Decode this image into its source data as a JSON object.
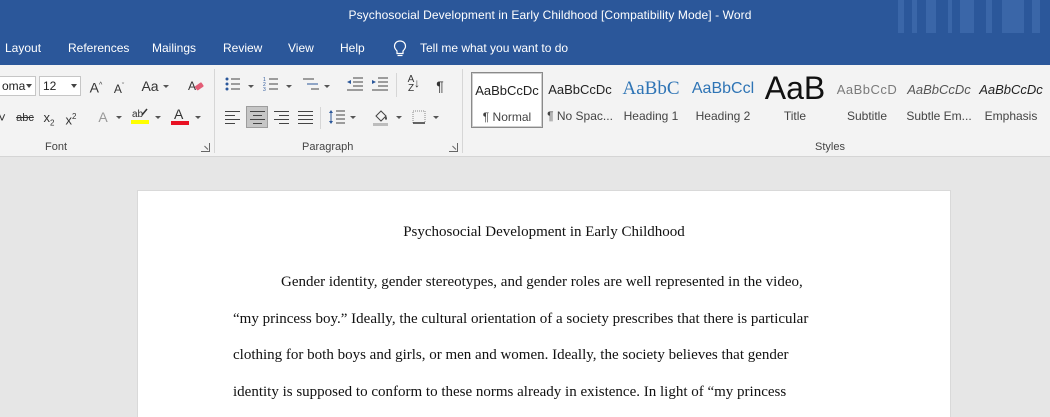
{
  "window": {
    "title": "Psychosocial Development in Early Childhood [Compatibility Mode]  -  Word"
  },
  "tabs": [
    "Layout",
    "References",
    "Mailings",
    "Review",
    "View",
    "Help"
  ],
  "tell_me": "Tell me what you want to do",
  "font": {
    "name_value": "oma",
    "size_value": "12",
    "group_label": "Font"
  },
  "paragraph": {
    "group_label": "Paragraph"
  },
  "styles": {
    "group_label": "Styles",
    "items": [
      {
        "sample": "AaBbCcDc",
        "name": "¶ Normal"
      },
      {
        "sample": "AaBbCcDc",
        "name": "¶ No Spac..."
      },
      {
        "sample": "AaBbC",
        "name": "Heading 1"
      },
      {
        "sample": "AaBbCcl",
        "name": "Heading 2"
      },
      {
        "sample": "AaB",
        "name": "Title"
      },
      {
        "sample": "AaBbCcD",
        "name": "Subtitle"
      },
      {
        "sample": "AaBbCcDc",
        "name": "Subtle Em..."
      },
      {
        "sample": "AaBbCcDc",
        "name": "Emphasis"
      }
    ]
  },
  "colors": {
    "word_blue": "#2b579a",
    "highlight_yellow": "#ffff00",
    "font_red": "#e81123"
  },
  "document": {
    "title": "Psychosocial Development in Early Childhood",
    "lines": [
      "Gender identity, gender stereotypes, and gender roles are well represented in the video,",
      "“my princess boy.” Ideally, the cultural orientation of a society prescribes that there is particular",
      "clothing for both boys and girls, or men and women. Ideally, the society believes that gender",
      "identity is supposed to conform to these norms already in existence. In light of “my princess"
    ]
  }
}
